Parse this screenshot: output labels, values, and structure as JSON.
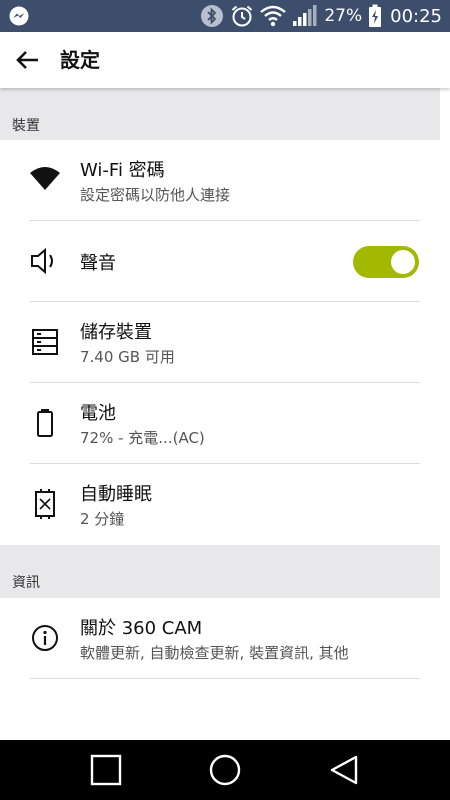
{
  "status_bar": {
    "battery_percent": "27%",
    "time": "00:25",
    "icons": [
      "messenger-icon",
      "bluetooth-icon",
      "alarm-icon",
      "wifi-icon",
      "signal-icon",
      "battery-charging-icon"
    ]
  },
  "app_bar": {
    "back_icon": "arrow-back-icon",
    "title": "設定"
  },
  "sections": [
    {
      "header": "裝置",
      "items": [
        {
          "title": "Wi-Fi 密碼",
          "subtitle": "設定密碼以防他人連接",
          "icon": "wifi-icon"
        },
        {
          "title": "聲音",
          "subtitle": "",
          "icon": "speaker-icon",
          "toggle_on": true
        },
        {
          "title": "儲存裝置",
          "subtitle": "7.40 GB 可用",
          "icon": "storage-icon"
        },
        {
          "title": "電池",
          "subtitle": "72% - 充電...(AC)",
          "icon": "battery-icon"
        },
        {
          "title": "自動睡眠",
          "subtitle": "2 分鐘",
          "icon": "sleep-timer-icon"
        }
      ]
    },
    {
      "header": "資訊",
      "items": [
        {
          "title": "關於 360 CAM",
          "subtitle": "軟體更新, 自動檢查更新, 裝置資訊, 其他",
          "icon": "info-icon"
        }
      ]
    }
  ],
  "nav_bar": {
    "buttons": [
      "recents-square-icon",
      "home-circle-icon",
      "back-triangle-icon"
    ]
  },
  "colors": {
    "status_bar": "#3c4e6c",
    "toggle_on": "#a3b800",
    "section_header_bg": "#e8e8ea",
    "nav_bar": "#000000"
  }
}
